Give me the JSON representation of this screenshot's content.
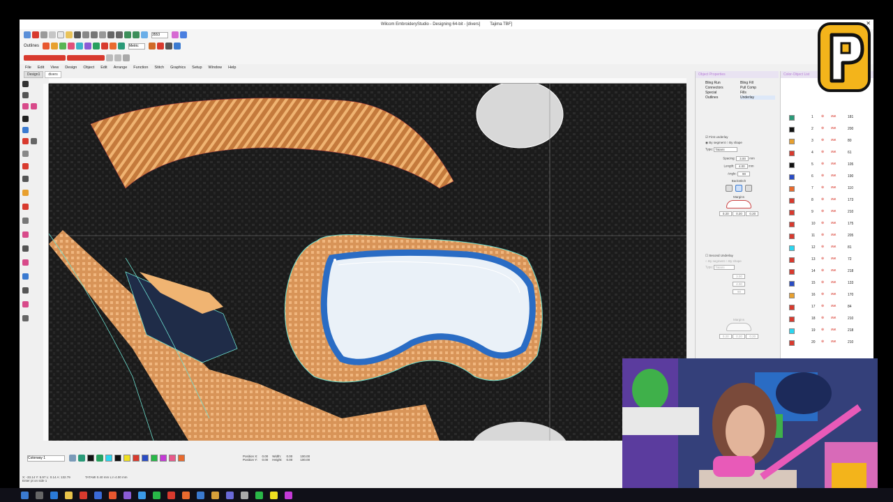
{
  "window": {
    "title": "Wilcom EmbroideryStudio - Designing 64-bit - [divers]",
    "machine": "Tajima TBF]"
  },
  "toolbar": {
    "outlines_label": "Outlines",
    "zoom_value": "3553",
    "units_label": "Metric"
  },
  "menu": {
    "items": [
      "File",
      "Edit",
      "View",
      "Design",
      "Object",
      "Edit",
      "Arrange",
      "Function",
      "Stitch",
      "Graphics",
      "Setup",
      "Window",
      "Help"
    ]
  },
  "doc_tabs": [
    {
      "label": "Design1"
    },
    {
      "label": "divers",
      "active": true
    }
  ],
  "object_properties": {
    "panel_title": "Object Properties",
    "tabs": [
      "Bling Run",
      "Connectors",
      "Special",
      "Outlines",
      "Bling Fill",
      "Pull Comp",
      "Fills",
      "Underlay"
    ],
    "first_underlay": {
      "label": "First underlay",
      "by_segment": "By segment",
      "by_shape": "By shape",
      "type_label": "Type:",
      "type_value": "Tatami",
      "spacing_label": "Spacing:",
      "spacing_value": "3.00",
      "length_label": "Length:",
      "length_value": "4.00",
      "angle_label": "Angle:",
      "angle_value": "90",
      "unit_mm": "mm",
      "backstitch_label": "Backstitch",
      "margins_label": "Margins",
      "margin_values": [
        "0.20",
        "0.20",
        "0.20"
      ]
    },
    "second_underlay": {
      "label": "Second Underlay",
      "by_segment": "By segment",
      "by_shape": "By shape",
      "type_label": "Type:",
      "type_value": "Tatami",
      "spacing_value": "3.00",
      "length_value": "4.00",
      "angle_value": "90",
      "margins_label": "Margins",
      "margin_values": [
        "0.20",
        "0.20",
        "0.20"
      ]
    }
  },
  "color_object_list": {
    "panel_title": "Color-Object List",
    "rows": [
      {
        "num": "1",
        "count": "181"
      },
      {
        "num": "2",
        "count": "200"
      },
      {
        "num": "3",
        "count": "80"
      },
      {
        "num": "4",
        "count": "61"
      },
      {
        "num": "5",
        "count": "105"
      },
      {
        "num": "6",
        "count": "190"
      },
      {
        "num": "7",
        "count": "110"
      },
      {
        "num": "8",
        "count": "173"
      },
      {
        "num": "9",
        "count": "210"
      },
      {
        "num": "10",
        "count": "175"
      },
      {
        "num": "11",
        "count": "205"
      },
      {
        "num": "12",
        "count": "81"
      },
      {
        "num": "13",
        "count": "72"
      },
      {
        "num": "14",
        "count": "218"
      },
      {
        "num": "15",
        "count": "133"
      },
      {
        "num": "16",
        "count": "170"
      },
      {
        "num": "17",
        "count": "84"
      },
      {
        "num": "18",
        "count": "210"
      },
      {
        "num": "19",
        "count": "218"
      },
      {
        "num": "20",
        "count": "210"
      }
    ]
  },
  "bottom": {
    "colorway_label": "Colorway 1",
    "position_x_label": "Position X:",
    "position_x_value": "0.00",
    "position_y_label": "Position Y:",
    "position_y_value": "0.00",
    "width_label": "Width:",
    "width_value": "0.00",
    "height_label": "Height:",
    "height_value": "0.00",
    "scale_x": "100.00",
    "scale_y": "100.00",
    "status_left": "X: -33.14  Y: 5.97  L: 0.14  A: 132.79",
    "status_mid": "TATAMI  0.40 mm  L:n  4.00 mm",
    "status_hint": "Enter pt on side 1"
  },
  "colors": {
    "canvas_bg": "#1d1d1d",
    "outline_cyan": "#6de0d0",
    "skin_tan": "#e2a066",
    "goggle_blue": "#2a6cc4",
    "logo_yellow": "#f3b41b"
  }
}
